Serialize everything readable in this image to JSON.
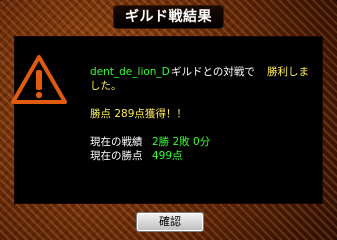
{
  "dialog": {
    "title": "ギルド戦結果",
    "message": {
      "guild_name": "dent_de_lion_D",
      "line1_mid": "ギルドとの対戦で",
      "line1_result": "勝利しま",
      "line2_result": "した。",
      "points_gained": "勝点 289点獲得！！",
      "record_label": "現在の戦績",
      "record_value": "2勝 2敗 0分",
      "points_label": "現在の勝点",
      "points_value": "499点"
    },
    "confirm_label": "確認"
  },
  "colors": {
    "green_text": "#33ff33",
    "yellow_text": "#ffee55",
    "frame": "#7a3410",
    "warning": "#e05a10"
  }
}
